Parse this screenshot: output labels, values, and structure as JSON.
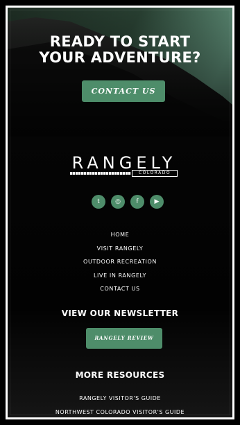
{
  "hero": {
    "title_line1": "READY TO START",
    "title_line2": "YOUR ADVENTURE?",
    "cta_label": "CONTACT US"
  },
  "logo": {
    "wordmark": "RANGELY",
    "subtitle": "COLORADO"
  },
  "socials": [
    {
      "name": "twitter-icon",
      "glyph": "t"
    },
    {
      "name": "instagram-icon",
      "glyph": "◎"
    },
    {
      "name": "facebook-icon",
      "glyph": "f"
    },
    {
      "name": "youtube-icon",
      "glyph": "▶"
    }
  ],
  "nav": {
    "items": [
      "HOME",
      "VISIT RANGELY",
      "OUTDOOR RECREATION",
      "LIVE IN RANGELY",
      "CONTACT US"
    ]
  },
  "newsletter": {
    "heading": "VIEW OUR NEWSLETTER",
    "button_label": "RANGELY REVIEW"
  },
  "resources": {
    "heading": "MORE RESOURCES",
    "items": [
      "RANGELY VISITOR'S GUIDE",
      "NORTHWEST COLORADO VISITOR'S GUIDE"
    ]
  },
  "colors": {
    "accent": "#4e8d6a",
    "background": "#050505",
    "frame": "#ffffff"
  }
}
